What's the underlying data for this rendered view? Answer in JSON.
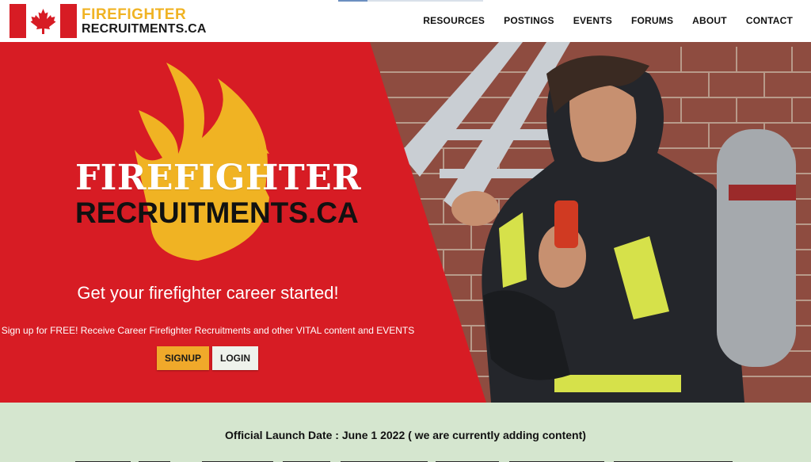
{
  "header": {
    "brand_top": "FIREFIGHTER",
    "brand_bottom": "RECRUITMENTS.CA",
    "nav": [
      "RESOURCES",
      "POSTINGS",
      "EVENTS",
      "FORUMS",
      "ABOUT",
      "CONTACT"
    ]
  },
  "hero": {
    "logo_top": "FIREFIGHTER",
    "logo_bottom": "RECRUITMENTS.CA",
    "tagline": "Get your firefighter career started!",
    "subtext": "Sign up for FREE! Receive Career Firefighter Recruitments and other VITAL content and EVENTS",
    "signup_label": "SIGNUP",
    "login_label": "LOGIN"
  },
  "band": {
    "launch": "Official Launch Date : June 1 2022 ( we are currently adding content)"
  },
  "colors": {
    "brand_red": "#d71c24",
    "brand_gold": "#f0b323",
    "band_green": "#d5e6cf"
  }
}
